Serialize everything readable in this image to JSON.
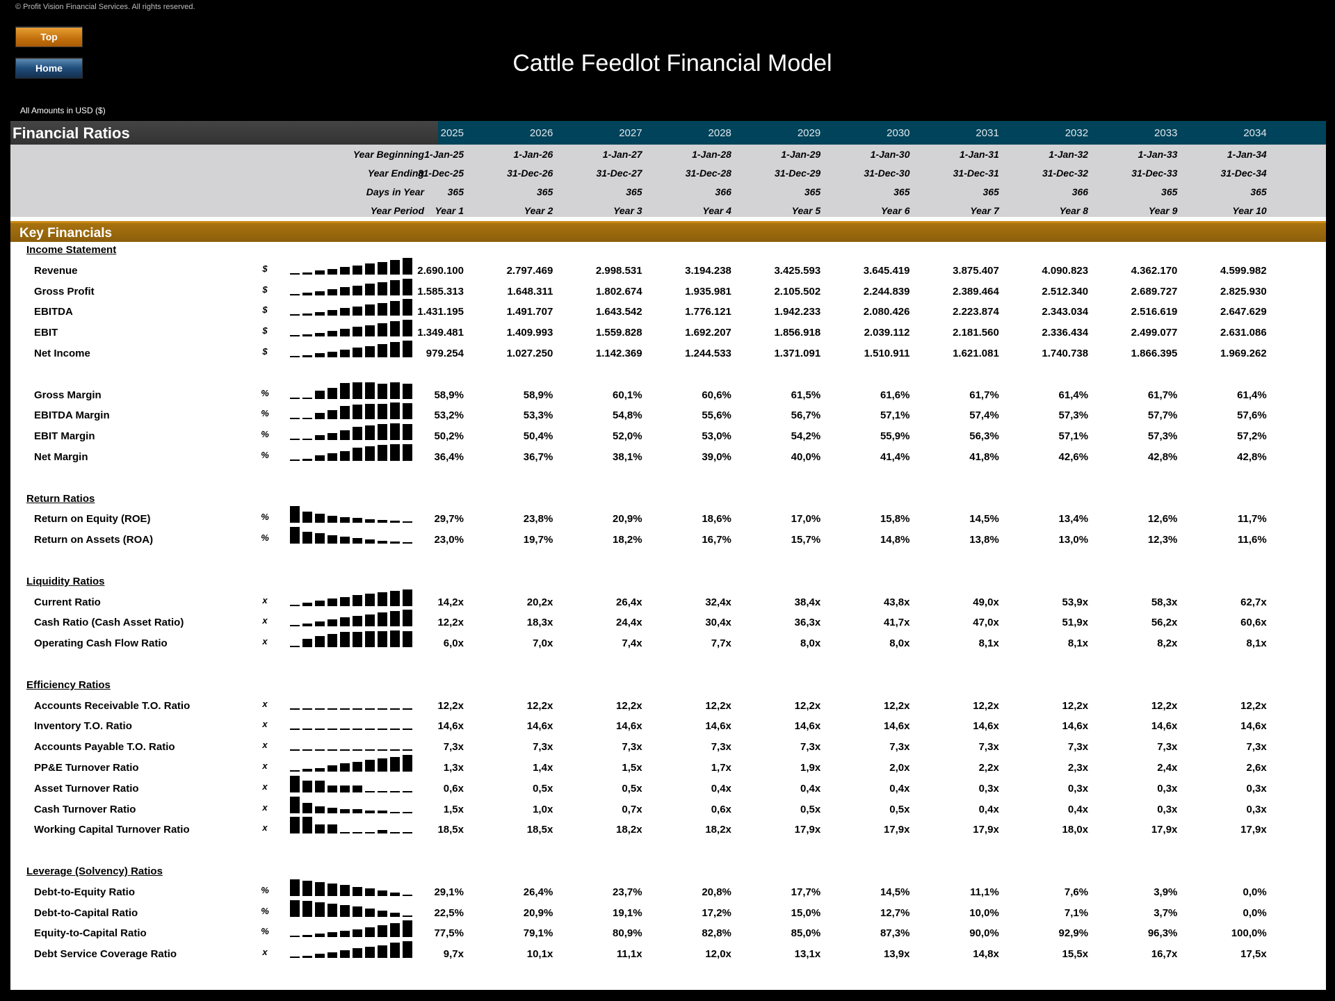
{
  "header": {
    "copyright": "© Profit Vision Financial Services. All rights reserved.",
    "title": "Cattle Feedlot Financial Model",
    "amounts_note": "All Amounts in  USD ($)",
    "buttons": {
      "top": "Top",
      "home": "Home"
    }
  },
  "colors": {
    "header_bar": "#00435a",
    "section_bar": "#9b680d",
    "dates_band": "#d3d3d6"
  },
  "sheet": {
    "title": "Financial Ratios",
    "years": [
      "2025",
      "2026",
      "2027",
      "2028",
      "2029",
      "2030",
      "2031",
      "2032",
      "2033",
      "2034"
    ],
    "date_rows": [
      {
        "label": "Year Beginning",
        "values": [
          "1-Jan-25",
          "1-Jan-26",
          "1-Jan-27",
          "1-Jan-28",
          "1-Jan-29",
          "1-Jan-30",
          "1-Jan-31",
          "1-Jan-32",
          "1-Jan-33",
          "1-Jan-34"
        ]
      },
      {
        "label": "Year Ending",
        "values": [
          "31-Dec-25",
          "31-Dec-26",
          "31-Dec-27",
          "31-Dec-28",
          "31-Dec-29",
          "31-Dec-30",
          "31-Dec-31",
          "31-Dec-32",
          "31-Dec-33",
          "31-Dec-34"
        ]
      },
      {
        "label": "Days in Year",
        "values": [
          "365",
          "365",
          "365",
          "366",
          "365",
          "365",
          "365",
          "366",
          "365",
          "365"
        ]
      },
      {
        "label": "Year Period",
        "values": [
          "Year 1",
          "Year 2",
          "Year 3",
          "Year 4",
          "Year 5",
          "Year 6",
          "Year 7",
          "Year 8",
          "Year 9",
          "Year 10"
        ]
      }
    ],
    "key_financials_label": "Key Financials",
    "sections": [
      {
        "title": "Income Statement",
        "rows": [
          {
            "label": "Revenue",
            "unit": "$",
            "values": [
              "2.690.100",
              "2.797.469",
              "2.998.531",
              "3.194.238",
              "3.425.593",
              "3.645.419",
              "3.875.407",
              "4.090.823",
              "4.362.170",
              "4.599.982"
            ]
          },
          {
            "label": "Gross Profit",
            "unit": "$",
            "values": [
              "1.585.313",
              "1.648.311",
              "1.802.674",
              "1.935.981",
              "2.105.502",
              "2.244.839",
              "2.389.464",
              "2.512.340",
              "2.689.727",
              "2.825.930"
            ]
          },
          {
            "label": "EBITDA",
            "unit": "$",
            "values": [
              "1.431.195",
              "1.491.707",
              "1.643.542",
              "1.776.121",
              "1.942.233",
              "2.080.426",
              "2.223.874",
              "2.343.034",
              "2.516.619",
              "2.647.629"
            ]
          },
          {
            "label": "EBIT",
            "unit": "$",
            "values": [
              "1.349.481",
              "1.409.993",
              "1.559.828",
              "1.692.207",
              "1.856.918",
              "2.039.112",
              "2.181.560",
              "2.336.434",
              "2.499.077",
              "2.631.086"
            ]
          },
          {
            "label": "Net Income",
            "unit": "$",
            "values": [
              "979.254",
              "1.027.250",
              "1.142.369",
              "1.244.533",
              "1.371.091",
              "1.510.911",
              "1.621.081",
              "1.740.738",
              "1.866.395",
              "1.969.262"
            ]
          },
          {
            "gap": true
          },
          {
            "label": "Gross Margin",
            "unit": "%",
            "values": [
              "58,9%",
              "58,9%",
              "60,1%",
              "60,6%",
              "61,5%",
              "61,6%",
              "61,7%",
              "61,4%",
              "61,7%",
              "61,4%"
            ]
          },
          {
            "label": "EBITDA Margin",
            "unit": "%",
            "values": [
              "53,2%",
              "53,3%",
              "54,8%",
              "55,6%",
              "56,7%",
              "57,1%",
              "57,4%",
              "57,3%",
              "57,7%",
              "57,6%"
            ]
          },
          {
            "label": "EBIT Margin",
            "unit": "%",
            "values": [
              "50,2%",
              "50,4%",
              "52,0%",
              "53,0%",
              "54,2%",
              "55,9%",
              "56,3%",
              "57,1%",
              "57,3%",
              "57,2%"
            ]
          },
          {
            "label": "Net Margin",
            "unit": "%",
            "values": [
              "36,4%",
              "36,7%",
              "38,1%",
              "39,0%",
              "40,0%",
              "41,4%",
              "41,8%",
              "42,6%",
              "42,8%",
              "42,8%"
            ]
          }
        ]
      },
      {
        "title": "Return Ratios",
        "rows": [
          {
            "label": "Return on Equity (ROE)",
            "unit": "%",
            "values": [
              "29,7%",
              "23,8%",
              "20,9%",
              "18,6%",
              "17,0%",
              "15,8%",
              "14,5%",
              "13,4%",
              "12,6%",
              "11,7%"
            ]
          },
          {
            "label": "Return on Assets (ROA)",
            "unit": "%",
            "values": [
              "23,0%",
              "19,7%",
              "18,2%",
              "16,7%",
              "15,7%",
              "14,8%",
              "13,8%",
              "13,0%",
              "12,3%",
              "11,6%"
            ]
          }
        ]
      },
      {
        "title": "Liquidity Ratios",
        "rows": [
          {
            "label": "Current Ratio",
            "unit": "x",
            "values": [
              "14,2x",
              "20,2x",
              "26,4x",
              "32,4x",
              "38,4x",
              "43,8x",
              "49,0x",
              "53,9x",
              "58,3x",
              "62,7x"
            ]
          },
          {
            "label": "Cash Ratio (Cash Asset Ratio)",
            "unit": "x",
            "values": [
              "12,2x",
              "18,3x",
              "24,4x",
              "30,4x",
              "36,3x",
              "41,7x",
              "47,0x",
              "51,9x",
              "56,2x",
              "60,6x"
            ]
          },
          {
            "label": "Operating Cash Flow Ratio",
            "unit": "x",
            "values": [
              "6,0x",
              "7,0x",
              "7,4x",
              "7,7x",
              "8,0x",
              "8,0x",
              "8,1x",
              "8,1x",
              "8,2x",
              "8,1x"
            ]
          }
        ]
      },
      {
        "title": "Efficiency Ratios",
        "rows": [
          {
            "label": "Accounts Receivable T.O. Ratio",
            "unit": "x",
            "values": [
              "12,2x",
              "12,2x",
              "12,2x",
              "12,2x",
              "12,2x",
              "12,2x",
              "12,2x",
              "12,2x",
              "12,2x",
              "12,2x"
            ]
          },
          {
            "label": "Inventory T.O. Ratio",
            "unit": "x",
            "values": [
              "14,6x",
              "14,6x",
              "14,6x",
              "14,6x",
              "14,6x",
              "14,6x",
              "14,6x",
              "14,6x",
              "14,6x",
              "14,6x"
            ]
          },
          {
            "label": "Accounts Payable T.O. Ratio",
            "unit": "x",
            "values": [
              "7,3x",
              "7,3x",
              "7,3x",
              "7,3x",
              "7,3x",
              "7,3x",
              "7,3x",
              "7,3x",
              "7,3x",
              "7,3x"
            ]
          },
          {
            "label": "PP&E Turnover Ratio",
            "unit": "x",
            "values": [
              "1,3x",
              "1,4x",
              "1,5x",
              "1,7x",
              "1,9x",
              "2,0x",
              "2,2x",
              "2,3x",
              "2,4x",
              "2,6x"
            ]
          },
          {
            "label": "Asset Turnover Ratio",
            "unit": "x",
            "values": [
              "0,6x",
              "0,5x",
              "0,5x",
              "0,4x",
              "0,4x",
              "0,4x",
              "0,3x",
              "0,3x",
              "0,3x",
              "0,3x"
            ]
          },
          {
            "label": "Cash Turnover Ratio",
            "unit": "x",
            "values": [
              "1,5x",
              "1,0x",
              "0,7x",
              "0,6x",
              "0,5x",
              "0,5x",
              "0,4x",
              "0,4x",
              "0,3x",
              "0,3x"
            ]
          },
          {
            "label": "Working Capital Turnover Ratio",
            "unit": "x",
            "values": [
              "18,5x",
              "18,5x",
              "18,2x",
              "18,2x",
              "17,9x",
              "17,9x",
              "17,9x",
              "18,0x",
              "17,9x",
              "17,9x"
            ]
          }
        ]
      },
      {
        "title": "Leverage (Solvency) Ratios",
        "rows": [
          {
            "label": "Debt-to-Equity Ratio",
            "unit": "%",
            "values": [
              "29,1%",
              "26,4%",
              "23,7%",
              "20,8%",
              "17,7%",
              "14,5%",
              "11,1%",
              "7,6%",
              "3,9%",
              "0,0%"
            ]
          },
          {
            "label": "Debt-to-Capital Ratio",
            "unit": "%",
            "values": [
              "22,5%",
              "20,9%",
              "19,1%",
              "17,2%",
              "15,0%",
              "12,7%",
              "10,0%",
              "7,1%",
              "3,7%",
              "0,0%"
            ]
          },
          {
            "label": "Equity-to-Capital Ratio",
            "unit": "%",
            "values": [
              "77,5%",
              "79,1%",
              "80,9%",
              "82,8%",
              "85,0%",
              "87,3%",
              "90,0%",
              "92,9%",
              "96,3%",
              "100,0%"
            ]
          },
          {
            "label": "Debt Service Coverage Ratio",
            "unit": "x",
            "values": [
              "9,7x",
              "10,1x",
              "11,1x",
              "12,0x",
              "13,1x",
              "13,9x",
              "14,8x",
              "15,5x",
              "16,7x",
              "17,5x"
            ]
          }
        ]
      }
    ]
  }
}
